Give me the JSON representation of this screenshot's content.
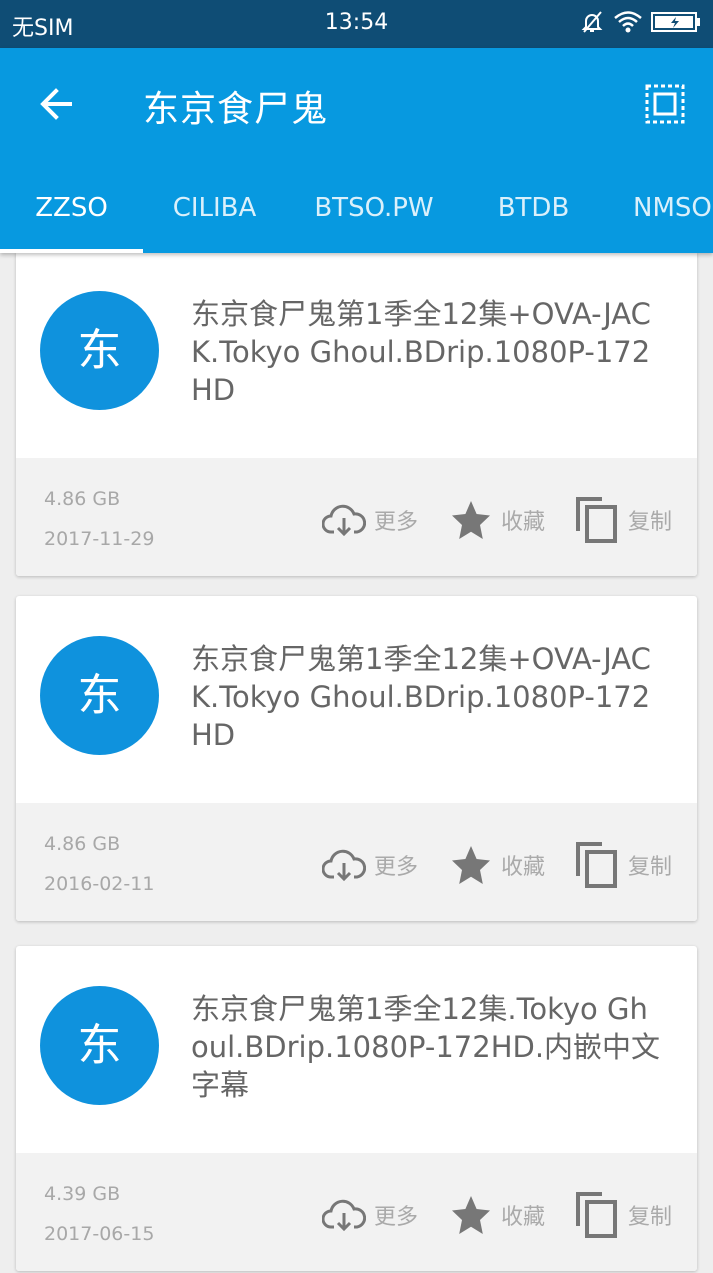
{
  "status_bar": {
    "carrier": "无SIM",
    "time": "13:54"
  },
  "app_bar": {
    "title": "东京食尸鬼"
  },
  "tabs": [
    {
      "label": "ZZSO",
      "active": true
    },
    {
      "label": "CILIBA"
    },
    {
      "label": "BTSO.PW"
    },
    {
      "label": "BTDB"
    },
    {
      "label": "NMSO"
    }
  ],
  "results": [
    {
      "avatar": "东",
      "title": "东京食尸鬼第1季全12集+OVA-JACK.Tokyo Ghoul.BDrip.1080P-172HD",
      "size": "4.86 GB",
      "date": "2017-11-29"
    },
    {
      "avatar": "东",
      "title": "东京食尸鬼第1季全12集+OVA-JACK.Tokyo Ghoul.BDrip.1080P-172HD",
      "size": "4.86 GB",
      "date": "2016-02-11"
    },
    {
      "avatar": "东",
      "title": "东京食尸鬼第1季全12集.Tokyo Ghoul.BDrip.1080P-172HD.内嵌中文字幕",
      "size": "4.39 GB",
      "date": "2017-06-15"
    }
  ],
  "actions": {
    "more": "更多",
    "favorite": "收藏",
    "copy": "复制"
  },
  "colors": {
    "status_bar": "#0f4d75",
    "app_bar": "#0799e0",
    "avatar": "#0f92dd",
    "footer": "#f2f2f2"
  }
}
